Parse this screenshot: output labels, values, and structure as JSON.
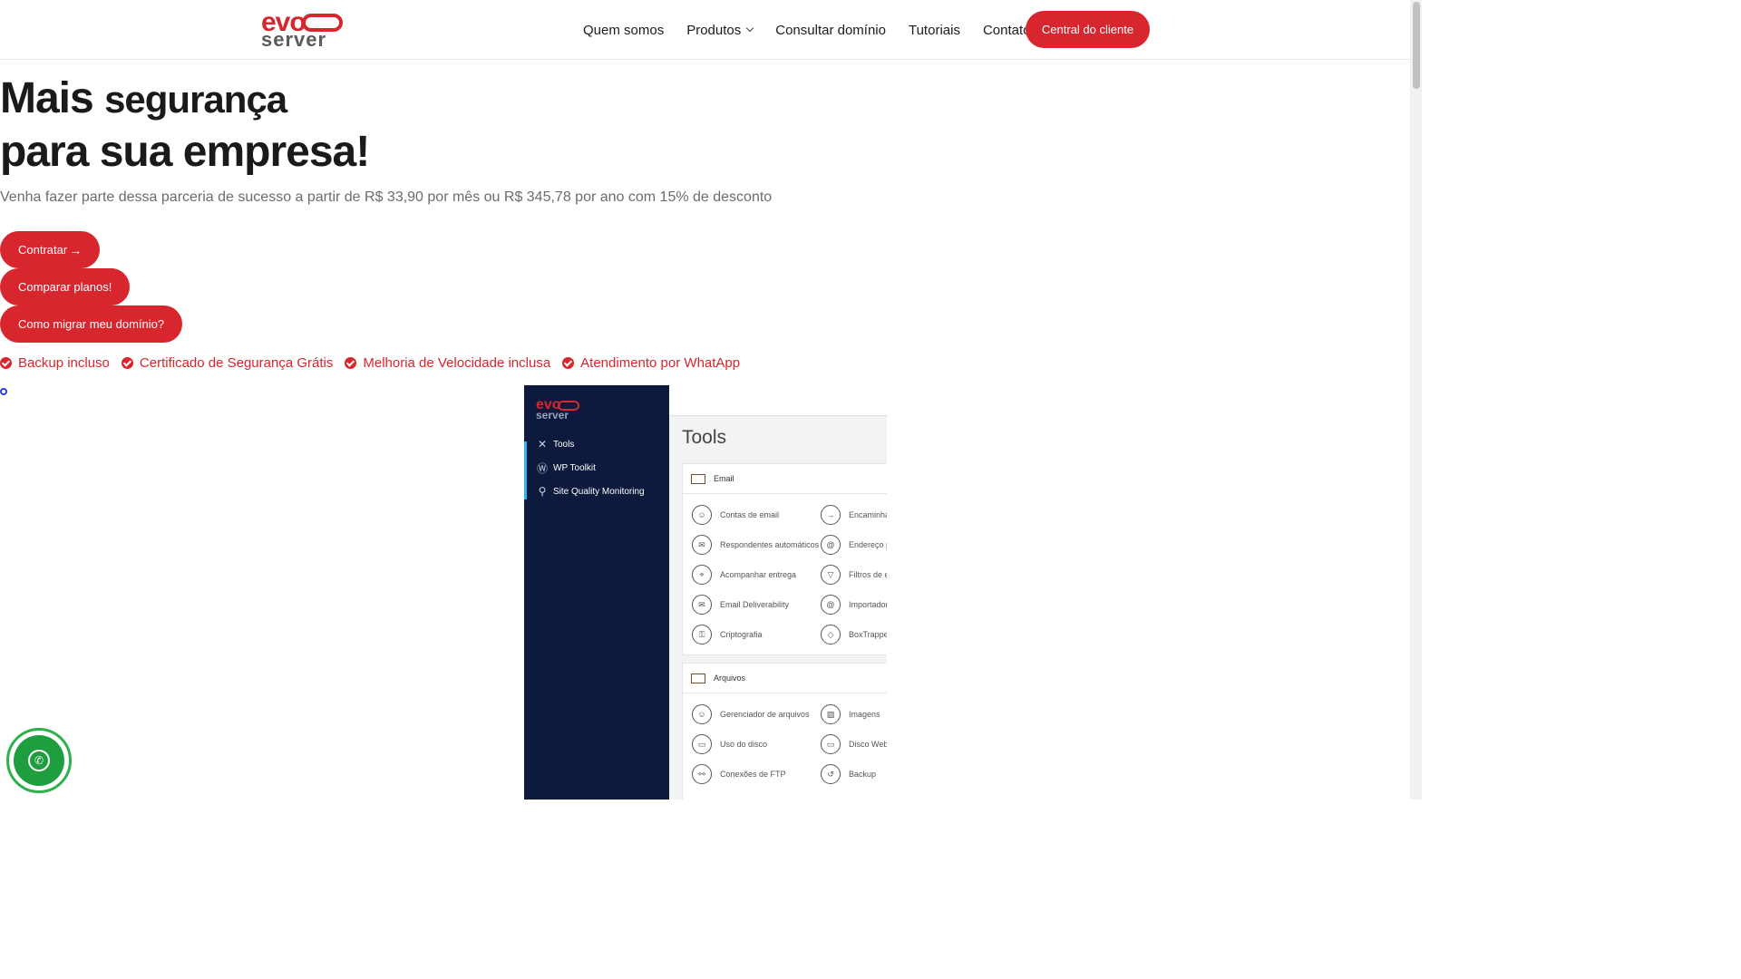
{
  "header": {
    "logo_top": "evo",
    "logo_bottom": "server",
    "nav": [
      "Quem somos",
      "Produtos",
      "Consultar domínio",
      "Tutoriais",
      "Contato"
    ],
    "cta": "Central do cliente"
  },
  "hero": {
    "title_part1": "Mais",
    "title_part2": "segurança",
    "title_line2": "para sua empresa!",
    "subtitle": "Venha fazer parte dessa parceria de sucesso a partir de R$ 33,90 por mês ou R$ 345,78 por ano com 15% de desconto",
    "buttons": [
      "Contratar",
      "Comparar planos!",
      "Como migrar meu domínio?"
    ],
    "arrow_symbol": "→",
    "features": [
      "Backup incluso",
      "Certificado de Segurança Grátis",
      "Melhoria de Velocidade inclusa",
      "Atendimento por WhatApp"
    ]
  },
  "mockup": {
    "logo_top": "evo",
    "logo_bottom": "server",
    "sidebar": [
      "Tools",
      "WP Toolkit",
      "Site Quality Monitoring"
    ],
    "title": "Tools",
    "email_section": {
      "title": "Email",
      "left": [
        "Contas de email",
        "Respondentes automáticos",
        "Acompanhar entrega",
        "Email Deliverability",
        "Criptografia"
      ],
      "right": [
        "Encaminhad",
        "Endereço pa",
        "Filtros de er",
        "Importador",
        "BoxTrapper"
      ]
    },
    "files_section": {
      "title": "Arquivos",
      "left": [
        "Gerenciador de arquivos",
        "Uso do disco",
        "Conexões de FTP"
      ],
      "right": [
        "Imagens",
        "Disco Web",
        "Backup"
      ]
    }
  },
  "colors": {
    "brand": "#d7262e",
    "sidebar": "#0d1a3d",
    "whatsapp": "#1f9e3f"
  },
  "icons": [
    "whatsapp-icon",
    "check-icon",
    "chevron-down-icon",
    "arrow-right-icon"
  ]
}
